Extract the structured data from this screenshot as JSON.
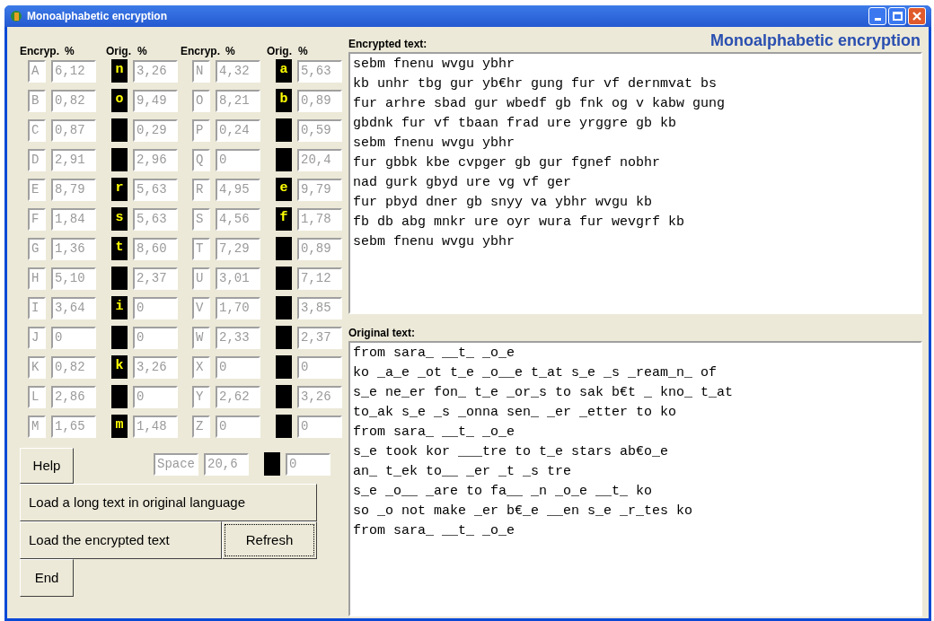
{
  "window": {
    "title": "Monoalphabetic encryption"
  },
  "heading": "Monoalphabetic encryption",
  "table": {
    "columns": [
      "Encryp.",
      "%",
      "Orig.",
      "%",
      "Encryp.",
      "%",
      "Orig.",
      "%"
    ],
    "rows": [
      {
        "left": {
          "enc": "A",
          "enc_pct": "6,12",
          "orig": "n",
          "orig_pct": "3,26"
        },
        "right": {
          "enc": "N",
          "enc_pct": "4,32",
          "orig": "a",
          "orig_pct": "5,63"
        }
      },
      {
        "left": {
          "enc": "B",
          "enc_pct": "0,82",
          "orig": "o",
          "orig_pct": "9,49"
        },
        "right": {
          "enc": "O",
          "enc_pct": "8,21",
          "orig": "b",
          "orig_pct": "0,89"
        }
      },
      {
        "left": {
          "enc": "C",
          "enc_pct": "0,87",
          "orig_pct": "0,29"
        },
        "right": {
          "enc": "P",
          "enc_pct": "0,24",
          "orig_pct": "0,59"
        }
      },
      {
        "left": {
          "enc": "D",
          "enc_pct": "2,91",
          "orig_pct": "2,96"
        },
        "right": {
          "enc": "Q",
          "enc_pct": "0",
          "orig_pct": "20,4"
        }
      },
      {
        "left": {
          "enc": "E",
          "enc_pct": "8,79",
          "orig": "r",
          "orig_pct": "5,63"
        },
        "right": {
          "enc": "R",
          "enc_pct": "4,95",
          "orig": "e",
          "orig_pct": "9,79"
        }
      },
      {
        "left": {
          "enc": "F",
          "enc_pct": "1,84",
          "orig": "s",
          "orig_pct": "5,63"
        },
        "right": {
          "enc": "S",
          "enc_pct": "4,56",
          "orig": "f",
          "orig_pct": "1,78"
        }
      },
      {
        "left": {
          "enc": "G",
          "enc_pct": "1,36",
          "orig": "t",
          "orig_pct": "8,60"
        },
        "right": {
          "enc": "T",
          "enc_pct": "7,29",
          "orig_pct": "0,89"
        }
      },
      {
        "left": {
          "enc": "H",
          "enc_pct": "5,10",
          "orig_pct": "2,37"
        },
        "right": {
          "enc": "U",
          "enc_pct": "3,01",
          "orig_pct": "7,12"
        }
      },
      {
        "left": {
          "enc": "I",
          "enc_pct": "3,64",
          "orig": "i",
          "orig_pct": "0"
        },
        "right": {
          "enc": "V",
          "enc_pct": "1,70",
          "orig_pct": "3,85"
        }
      },
      {
        "left": {
          "enc": "J",
          "enc_pct": "0",
          "orig_pct": "0"
        },
        "right": {
          "enc": "W",
          "enc_pct": "2,33",
          "orig_pct": "2,37"
        }
      },
      {
        "left": {
          "enc": "K",
          "enc_pct": "0,82",
          "orig": "k",
          "orig_pct": "3,26"
        },
        "right": {
          "enc": "X",
          "enc_pct": "0",
          "orig_pct": "0"
        }
      },
      {
        "left": {
          "enc": "L",
          "enc_pct": "2,86",
          "orig_pct": "0"
        },
        "right": {
          "enc": "Y",
          "enc_pct": "2,62",
          "orig_pct": "3,26"
        }
      },
      {
        "left": {
          "enc": "M",
          "enc_pct": "1,65",
          "orig": "m",
          "orig_pct": "1,48"
        },
        "right": {
          "enc": "Z",
          "enc_pct": "0",
          "orig_pct": "0"
        }
      }
    ],
    "space": {
      "enc": "Space",
      "enc_pct": "20,6",
      "orig_pct": "0"
    }
  },
  "buttons": {
    "help": "Help",
    "load_long": "Load a long text in original language",
    "load_encrypted": "Load the encrypted text",
    "refresh": {
      "label": "Refresh",
      "focused": true
    },
    "end": "End"
  },
  "encrypted": {
    "label": "Encrypted text:",
    "lines": [
      "sebm fnenu wvgu ybhr",
      "kb unhr tbg gur yb€hr gung fur vf dernmvat bs",
      "fur arhre sbad gur wbedf gb fnk og v kabw gung",
      "gbdnk fur vf tbaan frad ure yrggre gb kb",
      "sebm fnenu wvgu ybhr",
      "fur gbbk kbe cvpger gb gur fgnef nobhr",
      "nad gurk gbyd ure vg vf ger",
      "fur pbyd dner gb snyy va ybhr wvgu kb",
      "fb db abg mnkr ure oyr wura fur wevgrf kb",
      "sebm fnenu wvgu ybhr"
    ]
  },
  "original": {
    "label": "Original text:",
    "lines": [
      "from sara_ __t_ _o_e",
      "ko _a_e _ot t_e _o__e t_at s_e _s _ream_n_ of",
      "s_e ne_er fon_ t_e _or_s to sak b€t _ kno_ t_at",
      "to_ak s_e _s _onna sen_ _er _etter to ko",
      "from sara_ __t_ _o_e",
      "s_e took kor ___tre to t_e stars ab€o_e",
      "an_ t_ek to__ _er _t _s tre",
      "s_e _o__ _are to fa__ _n _o_e __t_ ko",
      "so _o not make _er b€_e __en s_e _r_tes ko",
      "from sara_ __t_ _o_e"
    ]
  }
}
